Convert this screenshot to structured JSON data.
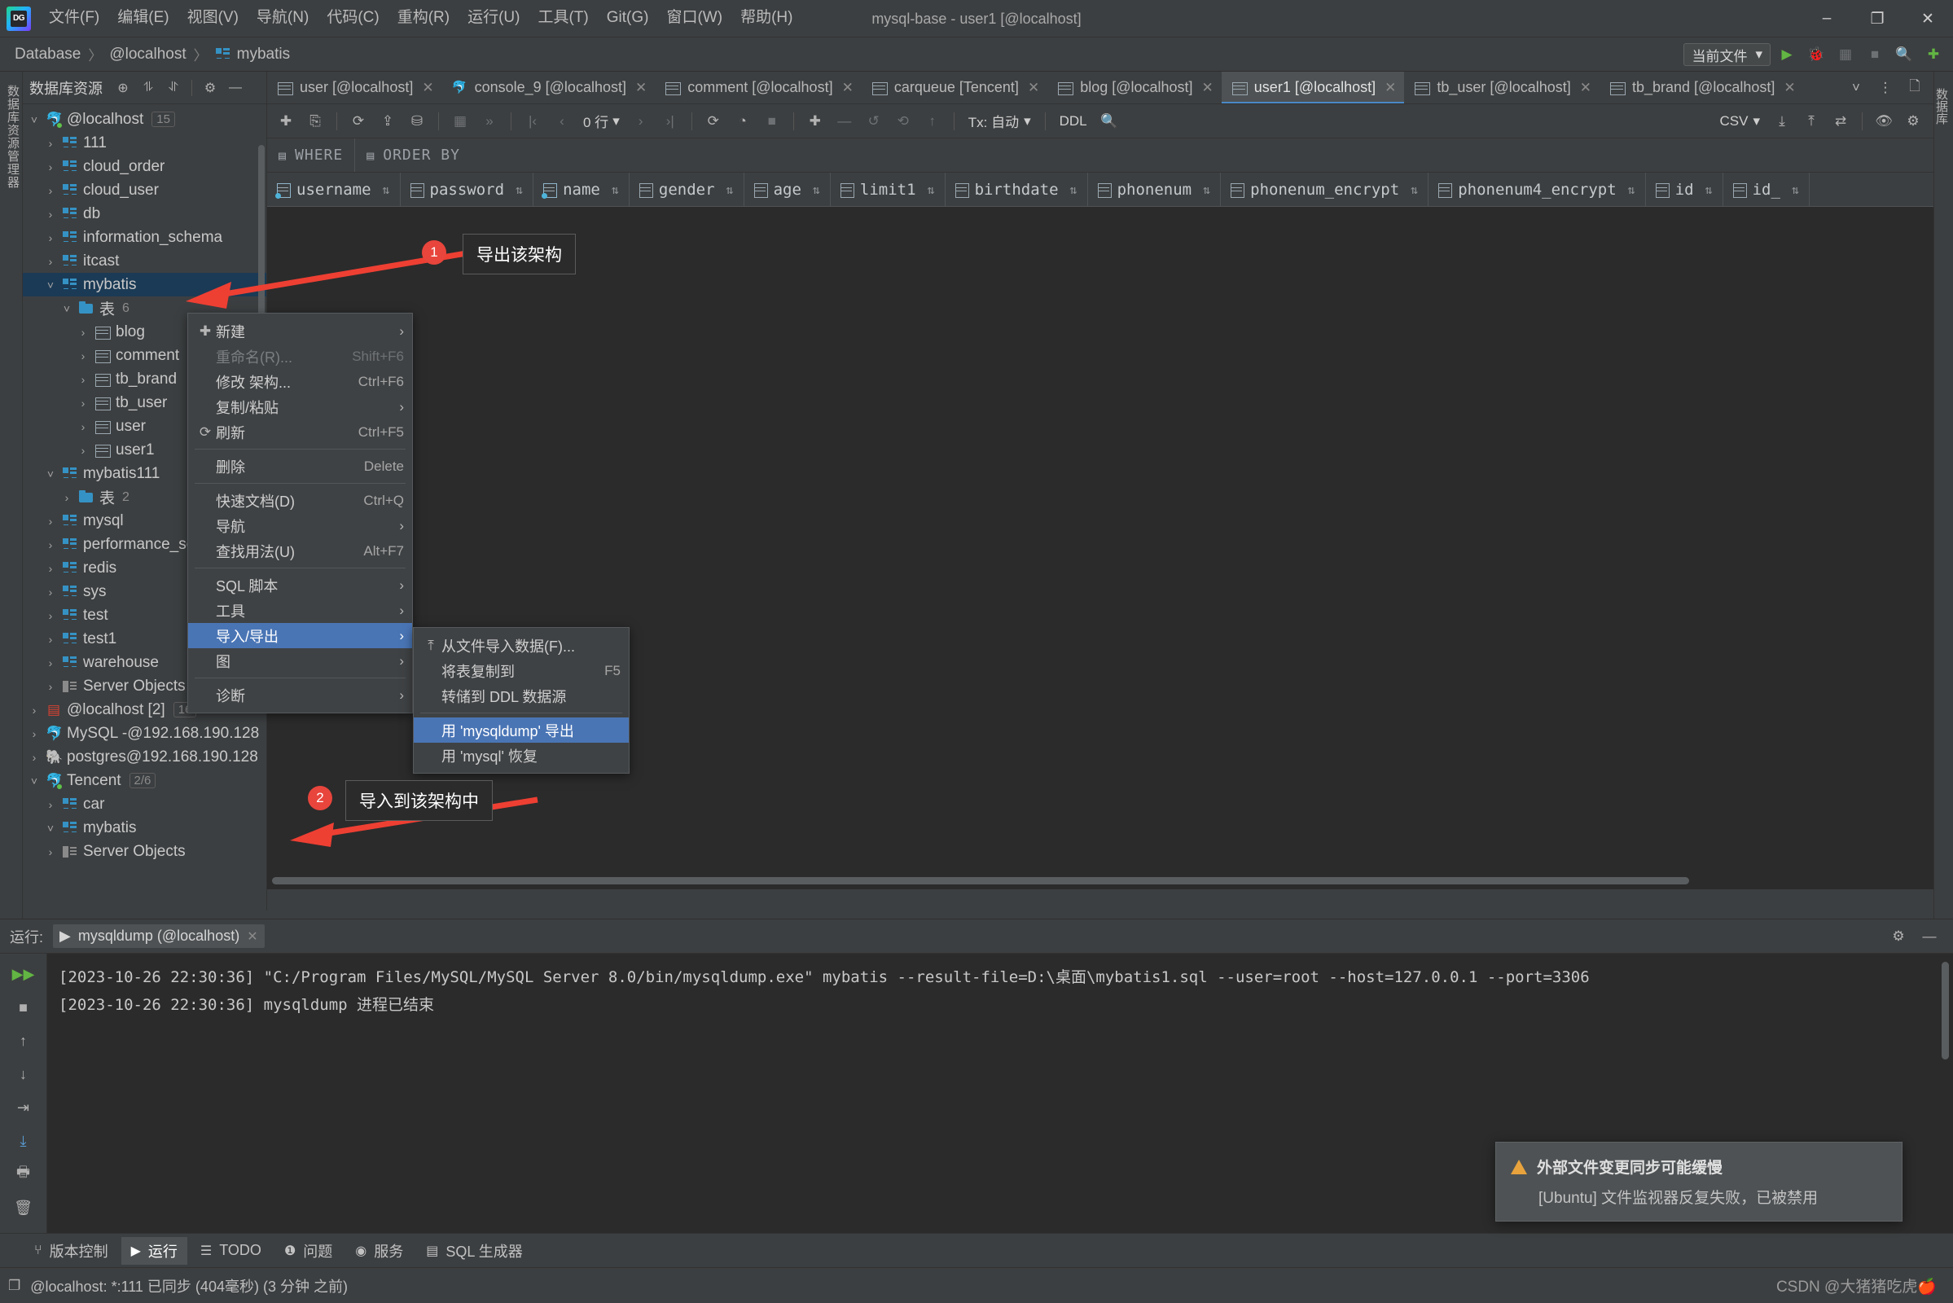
{
  "window": {
    "title": "mysql-base - user1 [@localhost]",
    "minimize": "–",
    "maximize": "❐",
    "close": "✕"
  },
  "menubar": {
    "items": [
      {
        "label": "文件(F)"
      },
      {
        "label": "编辑(E)"
      },
      {
        "label": "视图(V)"
      },
      {
        "label": "导航(N)"
      },
      {
        "label": "代码(C)"
      },
      {
        "label": "重构(R)"
      },
      {
        "label": "运行(U)"
      },
      {
        "label": "工具(T)"
      },
      {
        "label": "Git(G)"
      },
      {
        "label": "窗口(W)"
      },
      {
        "label": "帮助(H)"
      }
    ]
  },
  "navbar": {
    "crumbs": [
      "Database",
      "@localhost",
      "mybatis"
    ],
    "separator": "〉",
    "scope_selector": "当前文件",
    "chevron": "▾"
  },
  "left_strip": {
    "label": "数据库资源管理器"
  },
  "right_strip": {
    "label_top": "数据库",
    "label_bottom": "数据"
  },
  "sidebar": {
    "title": "数据库资源",
    "icons": [
      "target-icon",
      "expand-all-icon",
      "collapse-all-icon",
      "settings-icon",
      "hide-icon"
    ],
    "tree": [
      {
        "indent": 0,
        "arrow": "˅",
        "icon": "mysql",
        "label": "@localhost",
        "badge": "15",
        "state": "open"
      },
      {
        "indent": 1,
        "arrow": "›",
        "icon": "schema",
        "label": "111",
        "badge": "",
        "state": "closed"
      },
      {
        "indent": 1,
        "arrow": "›",
        "icon": "schema",
        "label": "cloud_order",
        "badge": "",
        "state": "closed"
      },
      {
        "indent": 1,
        "arrow": "›",
        "icon": "schema",
        "label": "cloud_user",
        "badge": "",
        "state": "closed"
      },
      {
        "indent": 1,
        "arrow": "›",
        "icon": "schema",
        "label": "db",
        "badge": "",
        "state": "closed"
      },
      {
        "indent": 1,
        "arrow": "›",
        "icon": "schema",
        "label": "information_schema",
        "badge": "",
        "state": "closed"
      },
      {
        "indent": 1,
        "arrow": "›",
        "icon": "schema",
        "label": "itcast",
        "badge": "",
        "state": "closed"
      },
      {
        "indent": 1,
        "arrow": "˅",
        "icon": "schema",
        "label": "mybatis",
        "badge": "",
        "state": "selected"
      },
      {
        "indent": 2,
        "arrow": "˅",
        "icon": "folder",
        "label": "表",
        "count": "6",
        "state": "open"
      },
      {
        "indent": 3,
        "arrow": "›",
        "icon": "table",
        "label": "blog",
        "state": "closed"
      },
      {
        "indent": 3,
        "arrow": "›",
        "icon": "table",
        "label": "comment",
        "state": "closed"
      },
      {
        "indent": 3,
        "arrow": "›",
        "icon": "table",
        "label": "tb_brand",
        "state": "closed"
      },
      {
        "indent": 3,
        "arrow": "›",
        "icon": "table",
        "label": "tb_user",
        "state": "closed"
      },
      {
        "indent": 3,
        "arrow": "›",
        "icon": "table",
        "label": "user",
        "state": "closed"
      },
      {
        "indent": 3,
        "arrow": "›",
        "icon": "table",
        "label": "user1",
        "state": "closed"
      },
      {
        "indent": 1,
        "arrow": "˅",
        "icon": "schema",
        "label": "mybatis111",
        "state": "open"
      },
      {
        "indent": 2,
        "arrow": "›",
        "icon": "folder",
        "label": "表",
        "count": "2",
        "state": "closed"
      },
      {
        "indent": 1,
        "arrow": "›",
        "icon": "schema",
        "label": "mysql",
        "state": "closed"
      },
      {
        "indent": 1,
        "arrow": "›",
        "icon": "schema",
        "label": "performance_schema",
        "state": "closed"
      },
      {
        "indent": 1,
        "arrow": "›",
        "icon": "schema",
        "label": "redis",
        "state": "closed"
      },
      {
        "indent": 1,
        "arrow": "›",
        "icon": "schema",
        "label": "sys",
        "state": "closed"
      },
      {
        "indent": 1,
        "arrow": "›",
        "icon": "schema",
        "label": "test",
        "state": "closed"
      },
      {
        "indent": 1,
        "arrow": "›",
        "icon": "schema",
        "label": "test1",
        "state": "closed"
      },
      {
        "indent": 1,
        "arrow": "›",
        "icon": "schema",
        "label": "warehouse",
        "state": "closed"
      },
      {
        "indent": 1,
        "arrow": "›",
        "icon": "server",
        "label": "Server Objects",
        "state": "closed"
      },
      {
        "indent": 0,
        "arrow": "›",
        "icon": "redis",
        "label": "@localhost [2]",
        "badge": "16",
        "state": "closed"
      },
      {
        "indent": 0,
        "arrow": "›",
        "icon": "mysql",
        "label": "MySQL -@192.168.190.128",
        "state": "closed"
      },
      {
        "indent": 0,
        "arrow": "›",
        "icon": "pg",
        "label": "postgres@192.168.190.128",
        "state": "closed"
      },
      {
        "indent": 0,
        "arrow": "˅",
        "icon": "mysql",
        "label": "Tencent",
        "badge": "2/6",
        "state": "open"
      },
      {
        "indent": 1,
        "arrow": "›",
        "icon": "schema",
        "label": "car",
        "state": "closed"
      },
      {
        "indent": 1,
        "arrow": "˅",
        "icon": "schema",
        "label": "mybatis",
        "state": "open"
      },
      {
        "indent": 1,
        "arrow": "›",
        "icon": "server",
        "label": "Server Objects",
        "state": "closed"
      }
    ]
  },
  "editor": {
    "tabs": [
      {
        "label": "user [@localhost]",
        "icon": "table-icon",
        "active": false
      },
      {
        "label": "console_9 [@localhost]",
        "icon": "mysql-icon",
        "active": false
      },
      {
        "label": "comment [@localhost]",
        "icon": "table-icon",
        "active": false
      },
      {
        "label": "carqueue [Tencent]",
        "icon": "table-icon",
        "active": false
      },
      {
        "label": "blog [@localhost]",
        "icon": "table-icon",
        "active": false
      },
      {
        "label": "user1 [@localhost]",
        "icon": "table-icon",
        "active": true
      },
      {
        "label": "tb_user [@localhost]",
        "icon": "table-icon",
        "active": false
      },
      {
        "label": "tb_brand [@localhost]",
        "icon": "table-icon",
        "active": false
      }
    ],
    "tab_close": "✕",
    "tabbar_more": "˅",
    "tabbar_options": "⋮",
    "toolbar": {
      "rows_label": "0 行",
      "tx_label": "Tx: 自动",
      "ddl_label": "DDL",
      "export_format": "CSV"
    },
    "filters": {
      "where_label": "WHERE",
      "orderby_label": "ORDER BY"
    },
    "columns": [
      {
        "name": "username",
        "key": true
      },
      {
        "name": "password",
        "key": false
      },
      {
        "name": "name",
        "key": true
      },
      {
        "name": "gender",
        "key": false
      },
      {
        "name": "age",
        "key": false
      },
      {
        "name": "limit1",
        "key": false
      },
      {
        "name": "birthdate",
        "key": false
      },
      {
        "name": "phonenum",
        "key": false
      },
      {
        "name": "phonenum_encrypt",
        "key": false
      },
      {
        "name": "phonenum4_encrypt",
        "key": false
      },
      {
        "name": "id",
        "key": false
      },
      {
        "name": "id_",
        "key": false
      }
    ],
    "sorter_glyph": "⇅"
  },
  "context_menu": {
    "items": [
      {
        "label": "新建",
        "icon": "plus-icon",
        "shortcut": "",
        "submenu": true,
        "state": "normal"
      },
      {
        "label": "重命名(R)...",
        "icon": "",
        "shortcut": "Shift+F6",
        "submenu": false,
        "state": "disabled"
      },
      {
        "label": "修改 架构...",
        "icon": "",
        "shortcut": "Ctrl+F6",
        "submenu": false,
        "state": "normal"
      },
      {
        "label": "复制/粘贴",
        "icon": "",
        "shortcut": "",
        "submenu": true,
        "state": "normal"
      },
      {
        "label": "刷新",
        "icon": "refresh-icon",
        "shortcut": "Ctrl+F5",
        "submenu": false,
        "state": "normal"
      },
      {
        "separator": true
      },
      {
        "label": "删除",
        "icon": "",
        "shortcut": "Delete",
        "submenu": false,
        "state": "normal"
      },
      {
        "separator": true
      },
      {
        "label": "快速文档(D)",
        "icon": "",
        "shortcut": "Ctrl+Q",
        "submenu": false,
        "state": "normal"
      },
      {
        "label": "导航",
        "icon": "",
        "shortcut": "",
        "submenu": true,
        "state": "normal"
      },
      {
        "label": "查找用法(U)",
        "icon": "",
        "shortcut": "Alt+F7",
        "submenu": false,
        "state": "normal"
      },
      {
        "separator": true
      },
      {
        "label": "SQL 脚本",
        "icon": "",
        "shortcut": "",
        "submenu": true,
        "state": "normal"
      },
      {
        "label": "工具",
        "icon": "",
        "shortcut": "",
        "submenu": true,
        "state": "normal"
      },
      {
        "label": "导入/导出",
        "icon": "",
        "shortcut": "",
        "submenu": true,
        "state": "highlighted"
      },
      {
        "label": "图",
        "icon": "",
        "shortcut": "",
        "submenu": true,
        "state": "normal"
      },
      {
        "separator": true
      },
      {
        "label": "诊断",
        "icon": "",
        "shortcut": "",
        "submenu": true,
        "state": "normal"
      }
    ],
    "chevron": "›"
  },
  "submenu": {
    "items": [
      {
        "label": "从文件导入数据(F)...",
        "icon": "import-icon",
        "shortcut": "",
        "state": "normal"
      },
      {
        "label": "将表复制到",
        "icon": "",
        "shortcut": "F5",
        "state": "normal"
      },
      {
        "label": "转储到 DDL 数据源",
        "icon": "",
        "shortcut": "",
        "state": "normal"
      },
      {
        "separator": true
      },
      {
        "label": "用 'mysqldump' 导出",
        "icon": "",
        "shortcut": "",
        "state": "highlighted"
      },
      {
        "label": "用 'mysql' 恢复",
        "icon": "",
        "shortcut": "",
        "state": "normal"
      }
    ]
  },
  "annotations": [
    {
      "number": "1",
      "text": "导出该架构"
    },
    {
      "number": "2",
      "text": "导入到该架构中"
    }
  ],
  "run_panel": {
    "label": "运行:",
    "tab_label": "mysqldump (@localhost)",
    "tab_close": "✕",
    "play_glyph": "▶",
    "console_lines": [
      "[2023-10-26 22:30:36] \"C:/Program Files/MySQL/MySQL Server 8.0/bin/mysqldump.exe\" mybatis --result-file=D:\\桌面\\mybatis1.sql --user=root --host=127.0.0.1 --port=3306",
      "[2023-10-26 22:30:36] mysqldump 进程已结束"
    ]
  },
  "notification": {
    "title": "外部文件变更同步可能缓慢",
    "body": "[Ubuntu] 文件监视器反复失败，已被禁用"
  },
  "bottom_bar": {
    "items": [
      {
        "label": "版本控制",
        "icon": "branch-icon",
        "active": false
      },
      {
        "label": "运行",
        "icon": "play-icon",
        "active": true
      },
      {
        "label": "TODO",
        "icon": "list-icon",
        "active": false
      },
      {
        "label": "问题",
        "icon": "error-icon",
        "active": false
      },
      {
        "label": "服务",
        "icon": "services-icon",
        "active": false
      },
      {
        "label": "SQL 生成器",
        "icon": "db-icon",
        "active": false
      }
    ]
  },
  "status_bar": {
    "text": "@localhost: *:111 已同步 (404毫秒) (3 分钟 之前)",
    "watermark": "CSDN @大猪猪吃虎🍎"
  },
  "colors": {
    "accent_blue": "#4a75b5",
    "selection": "#1b3a55",
    "annotation_red": "#e8453c",
    "warn_orange": "#e8a33d",
    "schema_icon": "#3592c4"
  }
}
